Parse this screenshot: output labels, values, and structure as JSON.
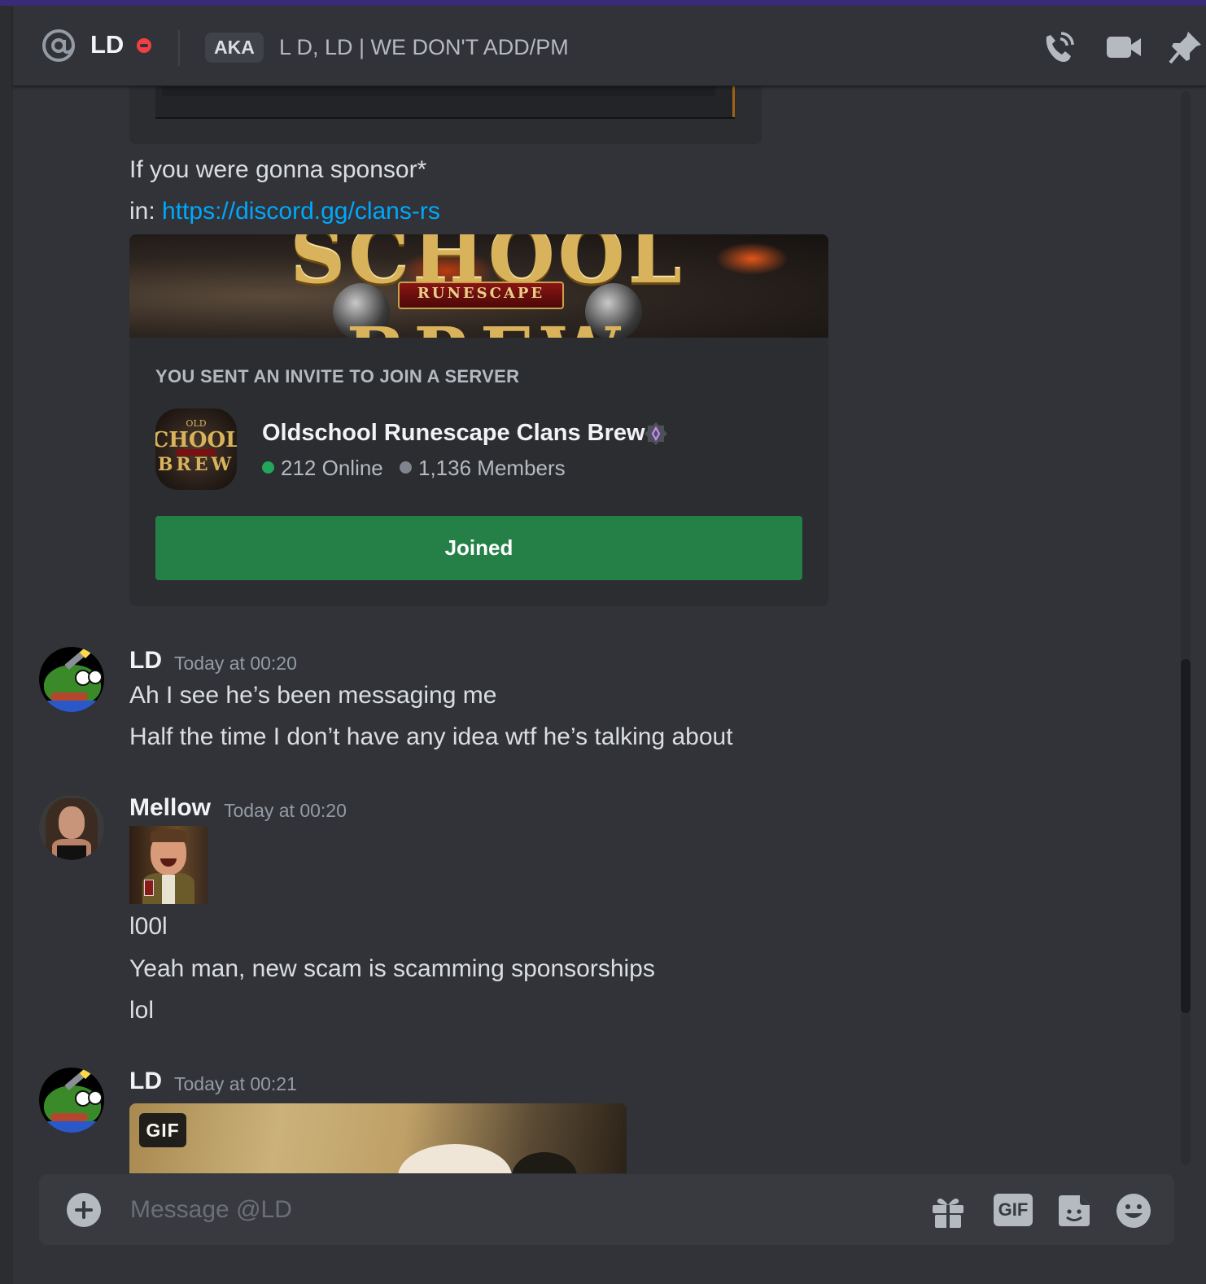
{
  "header": {
    "username": "LD",
    "aka_label": "AKA",
    "aka_names": "L D, LD | WE DON'T ADD/PM",
    "status": "do-not-disturb",
    "icons": [
      "at-sign-icon",
      "phone-call-icon",
      "video-camera-icon",
      "pin-icon"
    ]
  },
  "messages_top": {
    "line1": "If you were gonna sponsor*",
    "line2_prefix": "in: ",
    "line2_link": "https://discord.gg/clans-rs"
  },
  "invite": {
    "banner_title_top": "SCHOOL",
    "banner_subtitle": "RUNESCAPE",
    "banner_title_bottom": "BREW",
    "label": "YOU SENT AN INVITE TO JOIN A SERVER",
    "icon_top": "OLD",
    "icon_middle": "CHOOL",
    "icon_bottom": "BREW",
    "server_name": "Oldschool Runescape Clans Brew",
    "online": "212 Online",
    "members": "1,136 Members",
    "button": "Joined",
    "colors": {
      "online_dot": "#23a55a",
      "members_dot": "#80848e",
      "button": "#248046",
      "verified": "#a970ff"
    }
  },
  "messages": [
    {
      "author": "LD",
      "timestamp": "Today at 00:20",
      "lines": [
        "Ah I see he’s been messaging me",
        "Half the time I don’t have any idea wtf he’s talking about"
      ]
    },
    {
      "author": "Mellow",
      "timestamp": "Today at 00:20",
      "lines": [
        "l00l",
        "Yeah man, new scam is scamming sponsorships",
        "lol"
      ]
    },
    {
      "author": "LD",
      "timestamp": "Today at 00:21",
      "gif_badge": "GIF"
    }
  ],
  "composer": {
    "placeholder": "Message @LD",
    "gif_label": "GIF",
    "icons": [
      "add-attachment-icon",
      "gift-icon",
      "gif-icon",
      "sticker-icon",
      "emoji-icon"
    ]
  },
  "colors": {
    "background": "#313338",
    "link": "#00a8fc",
    "dnd": "#f23f43"
  }
}
